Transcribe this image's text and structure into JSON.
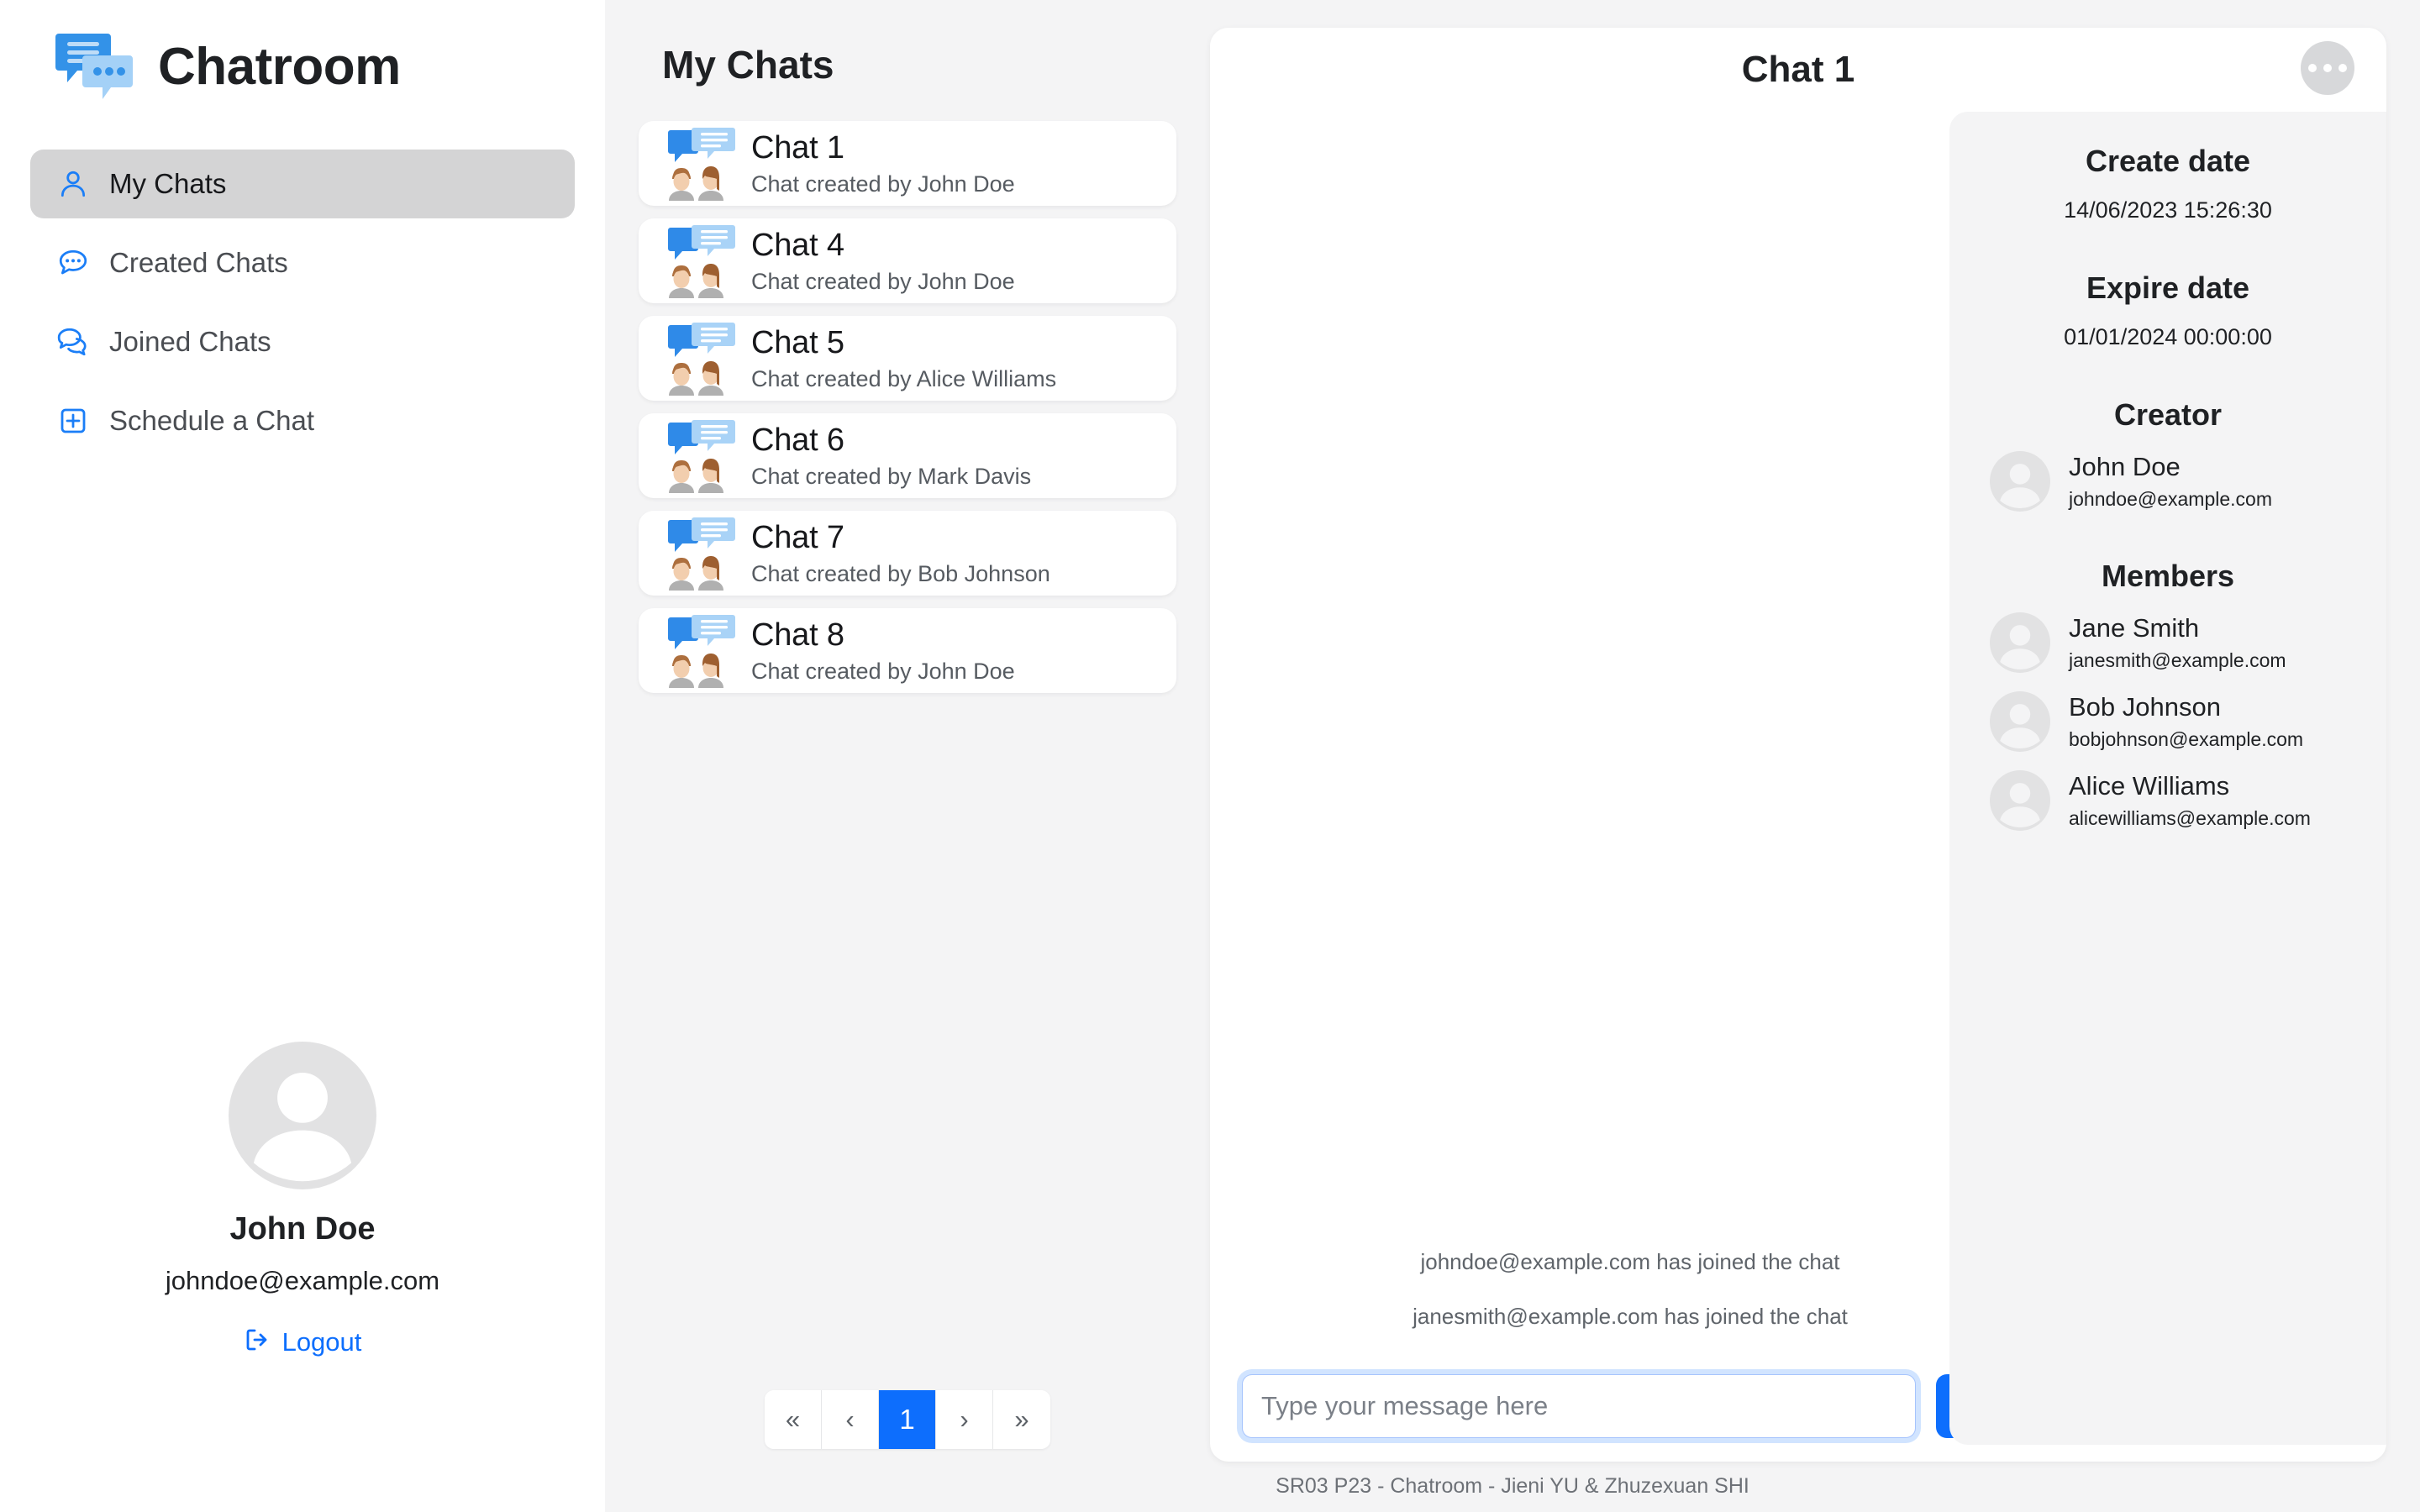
{
  "brand": {
    "title": "Chatroom",
    "logo_icon": "chat-bubbles-logo"
  },
  "sidebar": {
    "items": [
      {
        "label": "My Chats",
        "icon": "person-icon",
        "active": true
      },
      {
        "label": "Created Chats",
        "icon": "chat-bubble-dots-icon",
        "active": false
      },
      {
        "label": "Joined Chats",
        "icon": "chat-bubbles-pair-icon",
        "active": false
      },
      {
        "label": "Schedule a Chat",
        "icon": "plus-square-icon",
        "active": false
      }
    ],
    "profile": {
      "avatar_icon": "user-avatar-placeholder",
      "name": "John Doe",
      "email": "johndoe@example.com",
      "logout_label": "Logout",
      "logout_icon": "sign-out-icon"
    }
  },
  "chatlist": {
    "title": "My Chats",
    "cards": [
      {
        "name": "Chat 1",
        "subtitle": "Chat created by John Doe"
      },
      {
        "name": "Chat 4",
        "subtitle": "Chat created by John Doe"
      },
      {
        "name": "Chat 5",
        "subtitle": "Chat created by Alice Williams"
      },
      {
        "name": "Chat 6",
        "subtitle": "Chat created by Mark Davis"
      },
      {
        "name": "Chat 7",
        "subtitle": "Chat created by Bob Johnson"
      },
      {
        "name": "Chat 8",
        "subtitle": "Chat created by John Doe"
      }
    ],
    "pagination": {
      "first": "«",
      "prev": "‹",
      "current_page": "1",
      "next": "›",
      "last": "»"
    }
  },
  "chat": {
    "title": "Chat 1",
    "options_icon": "more-options-icon",
    "messages": [
      "johndoe@example.com has joined the chat",
      "janesmith@example.com has joined the chat"
    ],
    "composer": {
      "placeholder": "Type your message here",
      "value": "",
      "send_icon": "paper-plane-icon"
    }
  },
  "details": {
    "create_date_label": "Create date",
    "create_date_value": "14/06/2023 15:26:30",
    "expire_date_label": "Expire date",
    "expire_date_value": "01/01/2024 00:00:00",
    "creator_label": "Creator",
    "creator": {
      "name": "John Doe",
      "email": "johndoe@example.com"
    },
    "members_label": "Members",
    "members": [
      {
        "name": "Jane Smith",
        "email": "janesmith@example.com"
      },
      {
        "name": "Bob Johnson",
        "email": "bobjohnson@example.com"
      },
      {
        "name": "Alice Williams",
        "email": "alicewilliams@example.com"
      }
    ]
  },
  "footer": {
    "text": "SR03 P23 - Chatroom - Jieni YU & Zhuzexuan SHI"
  },
  "colors": {
    "accent": "#0d6efd",
    "panel_bg": "#f4f4f5",
    "active_nav": "#d4d4d5"
  }
}
